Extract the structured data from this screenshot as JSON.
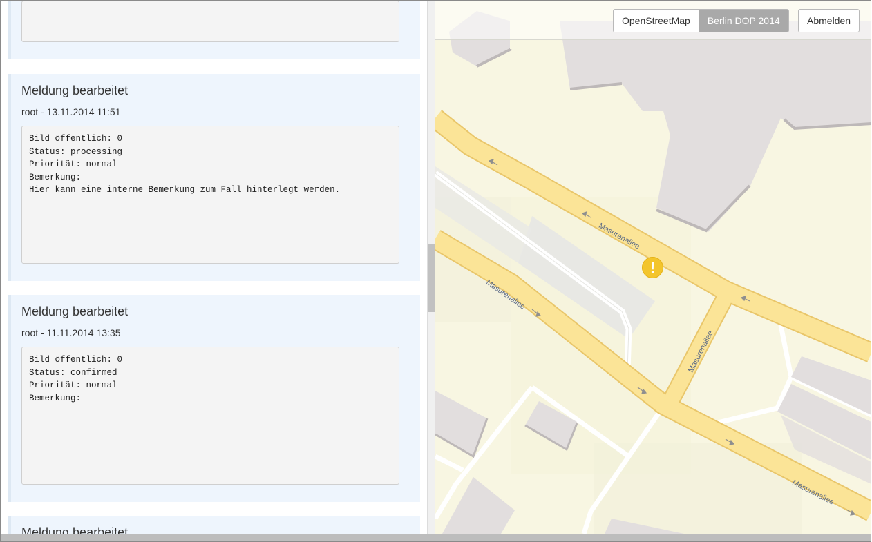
{
  "history": {
    "entries": [
      {
        "title": "",
        "meta": "",
        "details": ""
      },
      {
        "title": "Meldung bearbeitet",
        "meta": "root - 13.11.2014 11:51",
        "details": "Bild öffentlich: 0\nStatus: processing\nPriorität: normal\nBemerkung:\nHier kann eine interne Bemerkung zum Fall hinterlegt werden."
      },
      {
        "title": "Meldung bearbeitet",
        "meta": "root - 11.11.2014 13:35",
        "details": "Bild öffentlich: 0\nStatus: confirmed\nPriorität: normal\nBemerkung:"
      },
      {
        "title": "Meldung bearbeitet",
        "meta": "",
        "details": ""
      }
    ]
  },
  "map": {
    "layers": [
      {
        "label": "OpenStreetMap",
        "active": false
      },
      {
        "label": "Berlin DOP 2014",
        "active": true
      }
    ],
    "logout_label": "Abmelden",
    "street_labels": [
      "Masurenallee",
      "Masurenallee",
      "Masurenallee",
      "Masurenallee"
    ],
    "marker_symbol": "!",
    "marker_icon": "warning-icon",
    "colors": {
      "road_fill": "#fbe497",
      "road_edge": "#e9c66a",
      "building": "#e2dede",
      "background": "#f8f6e2",
      "marker": "#f3c52c"
    }
  }
}
